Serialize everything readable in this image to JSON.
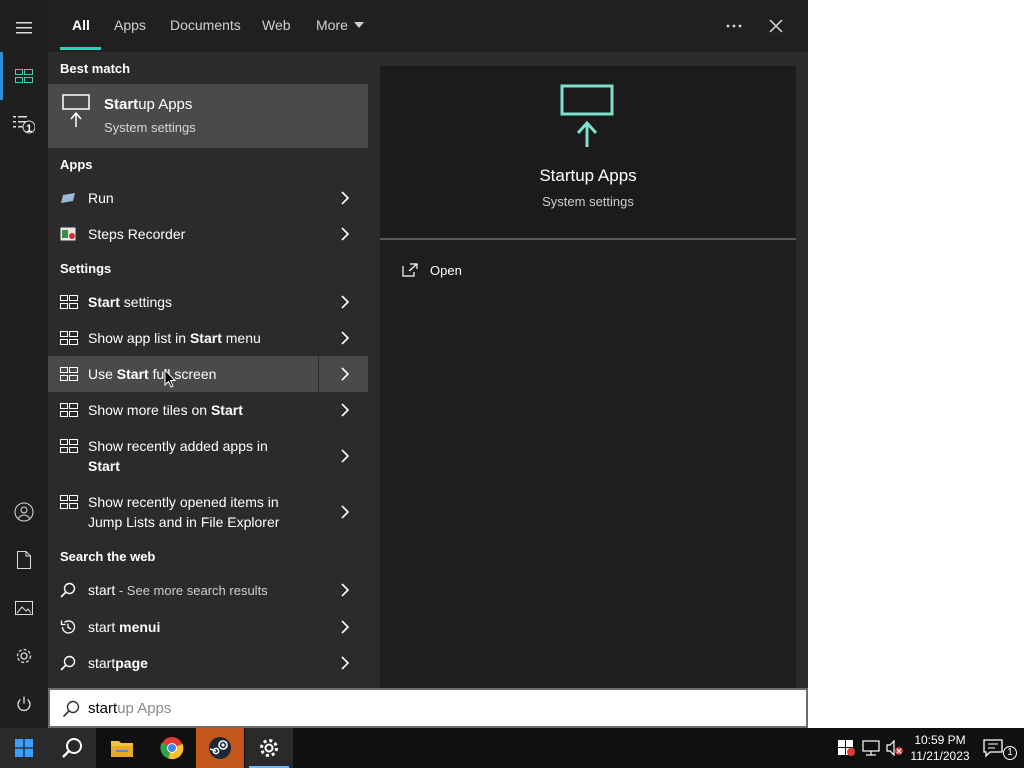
{
  "tabs": [
    {
      "label": "All",
      "active": true
    },
    {
      "label": "Apps"
    },
    {
      "label": "Documents"
    },
    {
      "label": "Web"
    },
    {
      "label": "More"
    }
  ],
  "top_buttons": {
    "more_options_icon": "ellipsis-icon",
    "close_icon": "close-icon"
  },
  "sections": {
    "best_match": "Best match",
    "apps": "Apps",
    "settings": "Settings",
    "search_web": "Search the web"
  },
  "best_match": {
    "title_bold": "Start",
    "title_rest": "up Apps",
    "subtitle": "System settings"
  },
  "apps": [
    {
      "label": "Run",
      "icon": "run-icon"
    },
    {
      "label": "Steps Recorder",
      "icon": "steps-recorder-icon"
    }
  ],
  "settings": [
    {
      "pre": "",
      "bold": "Start",
      "post": " settings"
    },
    {
      "pre": "Show app list in ",
      "bold": "Start",
      "post": " menu"
    },
    {
      "pre": "Use ",
      "bold": "Start",
      "post": " full screen"
    },
    {
      "pre": "Show more tiles on ",
      "bold": "Start",
      "post": ""
    },
    {
      "line1": "Show recently added apps in",
      "line2_bold": "Start"
    },
    {
      "line1": "Show recently opened items in",
      "line2": "Jump Lists and in File Explorer"
    }
  ],
  "web": [
    {
      "text": "start",
      "suffix": " - See more search results",
      "icon": "search-icon"
    },
    {
      "text": "start ",
      "bold": "menui",
      "icon": "history-icon"
    },
    {
      "text": "start",
      "bold": "page",
      "icon": "search-icon"
    }
  ],
  "preview": {
    "title": "Startup Apps",
    "subtitle": "System settings",
    "action": "Open"
  },
  "search": {
    "typed": "start",
    "suggestion": "up Apps"
  },
  "rail": {
    "badge": "1"
  },
  "clock": {
    "time": "10:59 PM",
    "date": "11/21/2023"
  },
  "notification_count": "1",
  "colors": {
    "accent": "#2fd0b8",
    "panel": "#2b2b2b",
    "hover": "#4a4a4a",
    "taskbar": "#101010"
  }
}
